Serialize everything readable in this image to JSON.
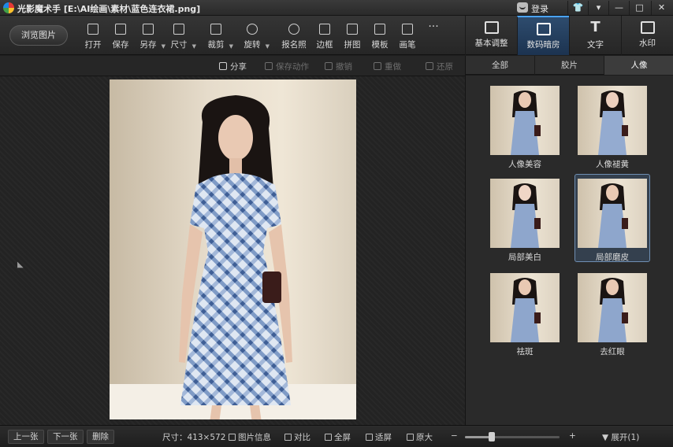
{
  "window": {
    "app_title": "光影魔术手 [E:\\AI绘画\\素材\\蓝色连衣裙.png]",
    "login_label": "登录",
    "controls": [
      "👕",
      "▬",
      "▾",
      "—",
      "□",
      "✕"
    ]
  },
  "toolbar": {
    "browse_label": "浏览图片",
    "tools": [
      {
        "label": "打开",
        "icon": "open-icon"
      },
      {
        "label": "保存",
        "icon": "save-icon"
      },
      {
        "label": "另存",
        "icon": "save-as-icon"
      },
      {
        "label": "尺寸",
        "icon": "resize-icon"
      },
      {
        "label": "裁剪",
        "icon": "crop-icon"
      },
      {
        "label": "旋转",
        "icon": "rotate-icon"
      },
      {
        "label": "报名照",
        "icon": "id-photo-icon"
      },
      {
        "label": "边框",
        "icon": "frame-icon"
      },
      {
        "label": "拼图",
        "icon": "collage-icon"
      },
      {
        "label": "模板",
        "icon": "template-icon"
      },
      {
        "label": "画笔",
        "icon": "brush-icon"
      },
      {
        "label": "···",
        "icon": "more-icon"
      }
    ],
    "right_tabs": [
      {
        "label": "基本调整",
        "icon": "basic-adjust-icon"
      },
      {
        "label": "数码暗房",
        "icon": "darkroom-icon"
      },
      {
        "label": "文字",
        "icon": "text-icon",
        "glyph": "T"
      },
      {
        "label": "水印",
        "icon": "watermark-icon"
      }
    ]
  },
  "actions": {
    "share": "分享",
    "save_action": "保存动作",
    "undo": "撤销",
    "redo": "重做",
    "restore": "还原"
  },
  "panel": {
    "tabs": [
      "全部",
      "胶片",
      "人像"
    ],
    "active_tab": "人像",
    "effects": [
      {
        "label": "人像美容"
      },
      {
        "label": "人像褪黄"
      },
      {
        "label": "局部美白"
      },
      {
        "label": "局部磨皮",
        "selected": true
      },
      {
        "label": "祛斑"
      },
      {
        "label": "去红眼"
      }
    ]
  },
  "statusbar": {
    "prev": "上一张",
    "next": "下一张",
    "delete": "删除",
    "size_text": "尺寸：413×572",
    "info": "图片信息",
    "compare": "对比",
    "fullscreen": "全屏",
    "fit": "适屏",
    "original": "原大",
    "zoom_minus": "−",
    "zoom_plus": "+",
    "zoom_level": 0.28,
    "expand": "▼ 展开(1)"
  }
}
